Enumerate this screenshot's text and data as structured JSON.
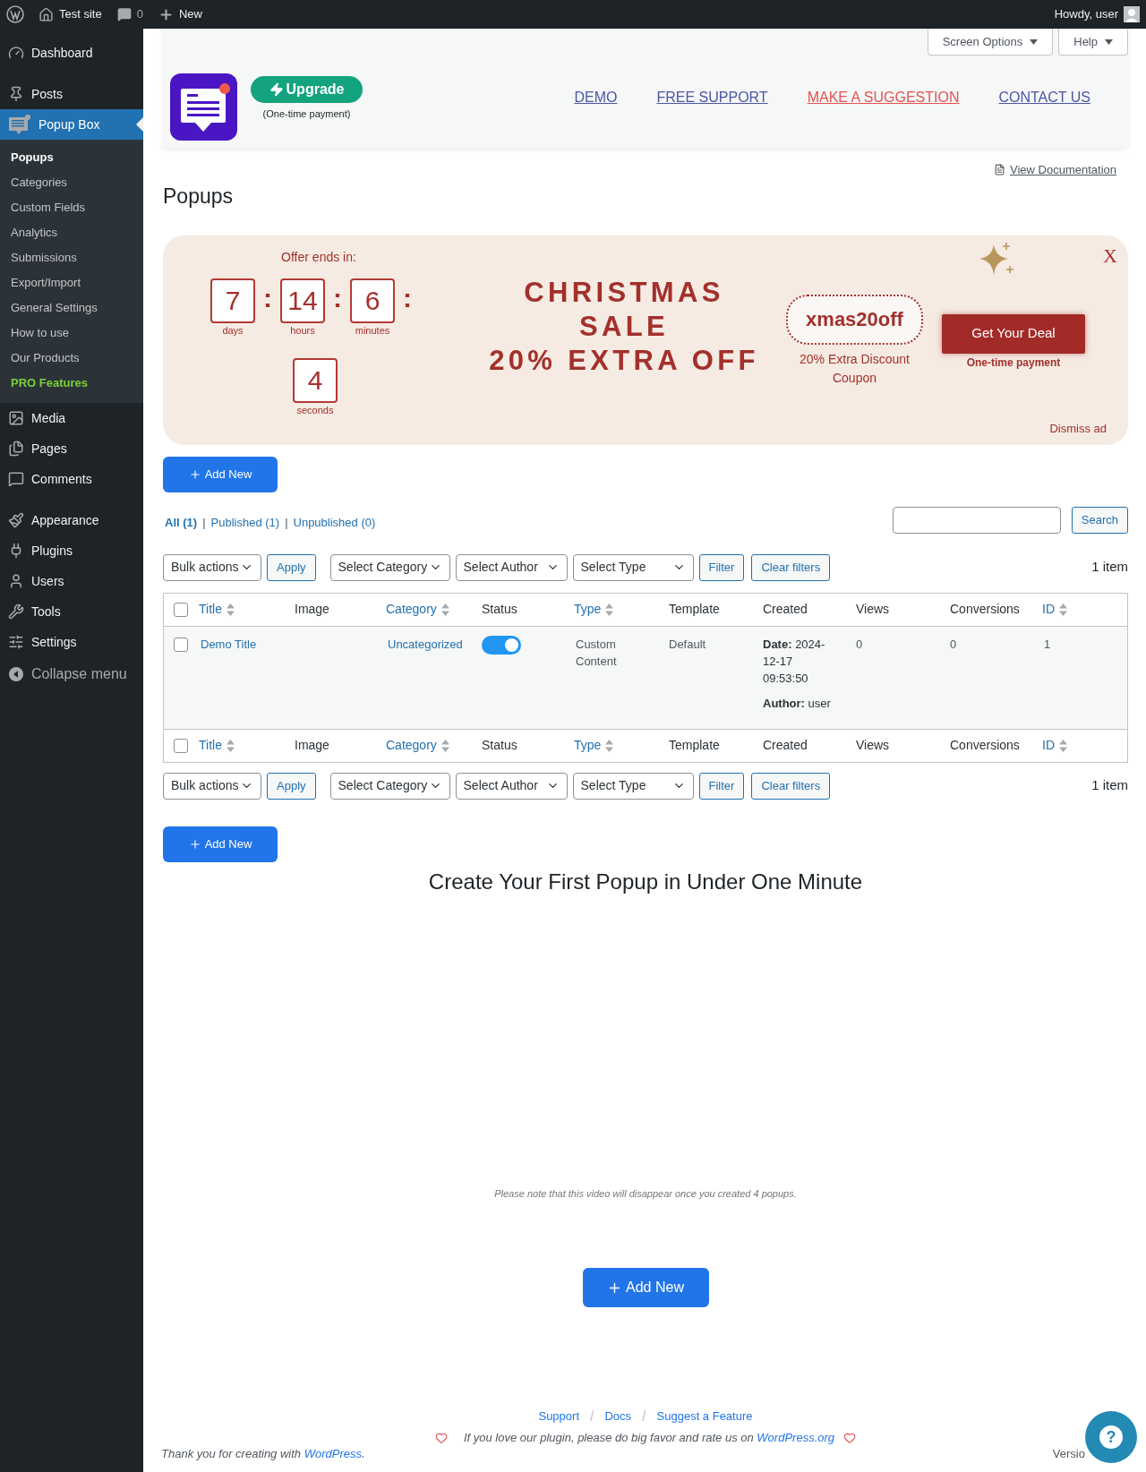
{
  "admin_bar": {
    "site": "Test site",
    "comments": "0",
    "new": "New",
    "greeting": "Howdy, user"
  },
  "sidebar": {
    "items": [
      {
        "label": "Dashboard",
        "selected": false
      },
      {
        "label": "Posts",
        "selected": false
      },
      {
        "label": "Popup Box",
        "selected": true,
        "children": [
          {
            "label": "Popups",
            "selected": true,
            "accent": false
          },
          {
            "label": "Categories",
            "selected": false,
            "accent": false
          },
          {
            "label": "Custom Fields",
            "selected": false,
            "accent": false
          },
          {
            "label": "Analytics",
            "selected": false,
            "accent": false
          },
          {
            "label": "Submissions",
            "selected": false,
            "accent": false
          },
          {
            "label": "Export/Import",
            "selected": false,
            "accent": false
          },
          {
            "label": "General Settings",
            "selected": false,
            "accent": false
          },
          {
            "label": "How to use",
            "selected": false,
            "accent": false
          },
          {
            "label": "Our Products",
            "selected": false,
            "accent": false
          },
          {
            "label": "PRO Features",
            "selected": false,
            "accent": true
          }
        ]
      },
      {
        "label": "Media",
        "selected": false
      },
      {
        "label": "Pages",
        "selected": false
      },
      {
        "label": "Comments",
        "selected": false
      },
      {
        "label": "Appearance",
        "selected": false
      },
      {
        "label": "Plugins",
        "selected": false
      },
      {
        "label": "Users",
        "selected": false
      },
      {
        "label": "Tools",
        "selected": false
      },
      {
        "label": "Settings",
        "selected": false
      }
    ],
    "collapse": "Collapse menu"
  },
  "screen_tabs": [
    "Screen Options",
    "Help"
  ],
  "plugin_header": {
    "upgrade": "Upgrade",
    "upgrade_note": "(One-time payment)",
    "links": [
      {
        "label": "DEMO",
        "kind": "normal"
      },
      {
        "label": "FREE SUPPORT",
        "kind": "normal"
      },
      {
        "label": "MAKE A SUGGESTION",
        "kind": "alert"
      },
      {
        "label": "CONTACT US",
        "kind": "normal"
      }
    ]
  },
  "view_docs": "View Documentation",
  "page_title": "Popups",
  "promo": {
    "offer_label": "Offer ends in:",
    "countdown": [
      {
        "value": "7",
        "label": "days",
        "separator": ":"
      },
      {
        "value": "14",
        "label": "hours",
        "separator": ":"
      },
      {
        "value": "6",
        "label": "minutes",
        "separator": ":"
      },
      {
        "value": "4",
        "label": "seconds"
      }
    ],
    "headline": [
      "CHRISTMAS",
      "SALE",
      "20% EXTRA OFF"
    ],
    "coupon": "xmas20off",
    "coupon_note": "20% Extra Discount Coupon",
    "cta": "Get Your Deal",
    "cta_note": "One-time payment",
    "close": "X",
    "dismiss": "Dismiss ad"
  },
  "add_new": "Add New",
  "views": [
    {
      "label": "All (1)",
      "selected": true
    },
    {
      "label": "Published (1)",
      "selected": false
    },
    {
      "label": "Unpublished (0)",
      "selected": false
    }
  ],
  "view_separators": [
    "|",
    "|"
  ],
  "search": {
    "button": "Search"
  },
  "top_filters": {
    "bulk": "Bulk actions",
    "apply": "Apply",
    "selects": [
      "Select Category",
      "Select Author",
      "Select Type"
    ],
    "filter": "Filter",
    "clear": "Clear filters",
    "count": "1 item"
  },
  "table": {
    "header_checked": false,
    "columns": [
      {
        "label": "Title",
        "sortable": true
      },
      {
        "label": "Image",
        "sortable": false
      },
      {
        "label": "Category",
        "sortable": true
      },
      {
        "label": "Status",
        "sortable": false
      },
      {
        "label": "Type",
        "sortable": true
      },
      {
        "label": "Template",
        "sortable": false
      },
      {
        "label": "Created",
        "sortable": false
      },
      {
        "label": "Views",
        "sortable": false
      },
      {
        "label": "Conversions",
        "sortable": false
      },
      {
        "label": "ID",
        "sortable": true
      }
    ],
    "rows": [
      {
        "checked": false,
        "title": "Demo Title",
        "category": "Uncategorized",
        "status_on": true,
        "type": "Custom Content",
        "template": "Default",
        "created": "**Date:** 2024-12-17 09:53:50",
        "author": "**Author:** user",
        "views": "0",
        "conversions": "0",
        "id": "1"
      }
    ],
    "footer_checked": false,
    "footer_columns": [
      {
        "label": "Title",
        "sortable": true
      },
      {
        "label": "Image",
        "sortable": false
      },
      {
        "label": "Category",
        "sortable": true
      },
      {
        "label": "Status",
        "sortable": false
      },
      {
        "label": "Type",
        "sortable": true
      },
      {
        "label": "Template",
        "sortable": false
      },
      {
        "label": "Created",
        "sortable": false
      },
      {
        "label": "Views",
        "sortable": false
      },
      {
        "label": "Conversions",
        "sortable": false
      },
      {
        "label": "ID",
        "sortable": true
      }
    ]
  },
  "bottom_filters": {
    "bulk": "Bulk actions",
    "apply": "Apply",
    "selects": [
      "Select Category",
      "Select Author",
      "Select Type"
    ],
    "filter": "Filter",
    "clear": "Clear filters",
    "count": "1 item"
  },
  "add_new_2": "Add New",
  "intro_title": "Create Your First Popup in Under One Minute",
  "video_note": "Please note that this video will disappear once you created 4 popups.",
  "add_new_3": "Add New",
  "plugin_footer": {
    "links": [
      "Support",
      "Docs",
      "Suggest a Feature"
    ],
    "separators": [
      "/",
      "/"
    ],
    "love_text": "If you love our plugin, please do big favor and rate us on",
    "love_link": "WordPress.org"
  },
  "wp_footer": {
    "text": "Thank you for creating with",
    "link": "WordPress",
    "end": ".",
    "version": "Versio"
  },
  "help_bubble": "?"
}
